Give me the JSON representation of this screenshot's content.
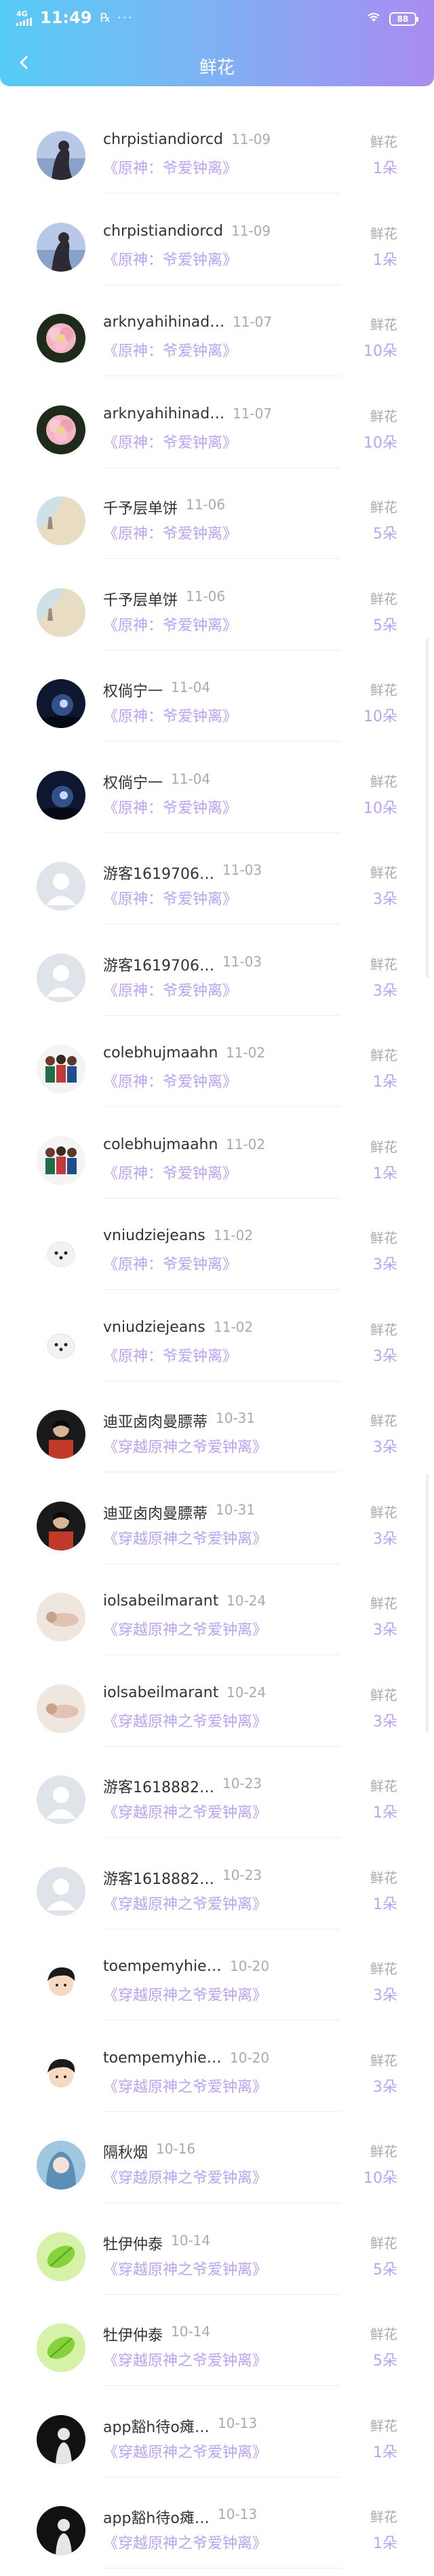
{
  "status_bar": {
    "network": "4G",
    "time": "11:49",
    "extra_icons": "℞ ···",
    "battery": "88"
  },
  "header": {
    "title": "鲜花"
  },
  "colors": {
    "accent": "#b9a3f2",
    "header_start": "#55ccf5",
    "header_end": "#a98cf1"
  },
  "items": [
    {
      "name": "chrpistiandiorcd",
      "date": "11-09",
      "book": "《原神：爷爱钟离》",
      "gift": "鲜花",
      "count": "1朵",
      "avatar": "dark-silhouette"
    },
    {
      "name": "chrpistiandiorcd",
      "date": "11-09",
      "book": "《原神：爷爱钟离》",
      "gift": "鲜花",
      "count": "1朵",
      "avatar": "dark-silhouette"
    },
    {
      "name": "arknyahihinad…",
      "date": "11-07",
      "book": "《原神：爷爱钟离》",
      "gift": "鲜花",
      "count": "10朵",
      "avatar": "pink-flower"
    },
    {
      "name": "arknyahihinad…",
      "date": "11-07",
      "book": "《原神：爷爱钟离》",
      "gift": "鲜花",
      "count": "10朵",
      "avatar": "pink-flower"
    },
    {
      "name": "千予层单饼",
      "date": "11-06",
      "book": "《原神：爷爱钟离》",
      "gift": "鲜花",
      "count": "5朵",
      "avatar": "beach"
    },
    {
      "name": "千予层单饼",
      "date": "11-06",
      "book": "《原神：爷爱钟离》",
      "gift": "鲜花",
      "count": "5朵",
      "avatar": "beach"
    },
    {
      "name": "权倘宁一",
      "date": "11-04",
      "book": "《原神：爷爱钟离》",
      "gift": "鲜花",
      "count": "10朵",
      "avatar": "night-sky"
    },
    {
      "name": "权倘宁一",
      "date": "11-04",
      "book": "《原神：爷爱钟离》",
      "gift": "鲜花",
      "count": "10朵",
      "avatar": "night-sky"
    },
    {
      "name": "游客1619706…",
      "date": "11-03",
      "book": "《原神：爷爱钟离》",
      "gift": "鲜花",
      "count": "3朵",
      "avatar": "default"
    },
    {
      "name": "游客1619706…",
      "date": "11-03",
      "book": "《原神：爷爱钟离》",
      "gift": "鲜花",
      "count": "3朵",
      "avatar": "default"
    },
    {
      "name": "colebhujmaahn",
      "date": "11-02",
      "book": "《原神：爷爱钟离》",
      "gift": "鲜花",
      "count": "1朵",
      "avatar": "group"
    },
    {
      "name": "colebhujmaahn",
      "date": "11-02",
      "book": "《原神：爷爱钟离》",
      "gift": "鲜花",
      "count": "1朵",
      "avatar": "group"
    },
    {
      "name": "vniudziejeans",
      "date": "11-02",
      "book": "《原神：爷爱钟离》",
      "gift": "鲜花",
      "count": "3朵",
      "avatar": "white-dog"
    },
    {
      "name": "vniudziejeans",
      "date": "11-02",
      "book": "《原神：爷爱钟离》",
      "gift": "鲜花",
      "count": "3朵",
      "avatar": "white-dog"
    },
    {
      "name": "迪亚卤肉曼膘蒂",
      "date": "10-31",
      "book": "《穿越原神之爷爱钟离》",
      "gift": "鲜花",
      "count": "3朵",
      "avatar": "dark-person"
    },
    {
      "name": "迪亚卤肉曼膘蒂",
      "date": "10-31",
      "book": "《穿越原神之爷爱钟离》",
      "gift": "鲜花",
      "count": "3朵",
      "avatar": "dark-person"
    },
    {
      "name": "iolsabeilmarant",
      "date": "10-24",
      "book": "《穿越原神之爷爱钟离》",
      "gift": "鲜花",
      "count": "3朵",
      "avatar": "lying-person"
    },
    {
      "name": "iolsabeilmarant",
      "date": "10-24",
      "book": "《穿越原神之爷爱钟离》",
      "gift": "鲜花",
      "count": "3朵",
      "avatar": "lying-person"
    },
    {
      "name": "游客1618882…",
      "date": "10-23",
      "book": "《穿越原神之爷爱钟离》",
      "gift": "鲜花",
      "count": "1朵",
      "avatar": "default"
    },
    {
      "name": "游客1618882…",
      "date": "10-23",
      "book": "《穿越原神之爷爱钟离》",
      "gift": "鲜花",
      "count": "1朵",
      "avatar": "default"
    },
    {
      "name": "toempemyhie…",
      "date": "10-20",
      "book": "《穿越原神之爷爱钟离》",
      "gift": "鲜花",
      "count": "3朵",
      "avatar": "cartoon-boy"
    },
    {
      "name": "toempemyhie…",
      "date": "10-20",
      "book": "《穿越原神之爷爱钟离》",
      "gift": "鲜花",
      "count": "3朵",
      "avatar": "cartoon-boy"
    },
    {
      "name": "隔秋烟",
      "date": "10-16",
      "book": "《穿越原神之爷爱钟离》",
      "gift": "鲜花",
      "count": "10朵",
      "avatar": "anime-girl"
    },
    {
      "name": "牡伊仲泰",
      "date": "10-14",
      "book": "《穿越原神之爷爱钟离》",
      "gift": "鲜花",
      "count": "5朵",
      "avatar": "green-leaf"
    },
    {
      "name": "牡伊仲泰",
      "date": "10-14",
      "book": "《穿越原神之爷爱钟离》",
      "gift": "鲜花",
      "count": "5朵",
      "avatar": "green-leaf"
    },
    {
      "name": "app豁h待o瘫…",
      "date": "10-13",
      "book": "《穿越原神之爷爱钟离》",
      "gift": "鲜花",
      "count": "1朵",
      "avatar": "bw-figure"
    },
    {
      "name": "app豁h待o瘫…",
      "date": "10-13",
      "book": "《穿越原神之爷爱钟离》",
      "gift": "鲜花",
      "count": "1朵",
      "avatar": "bw-figure"
    }
  ]
}
